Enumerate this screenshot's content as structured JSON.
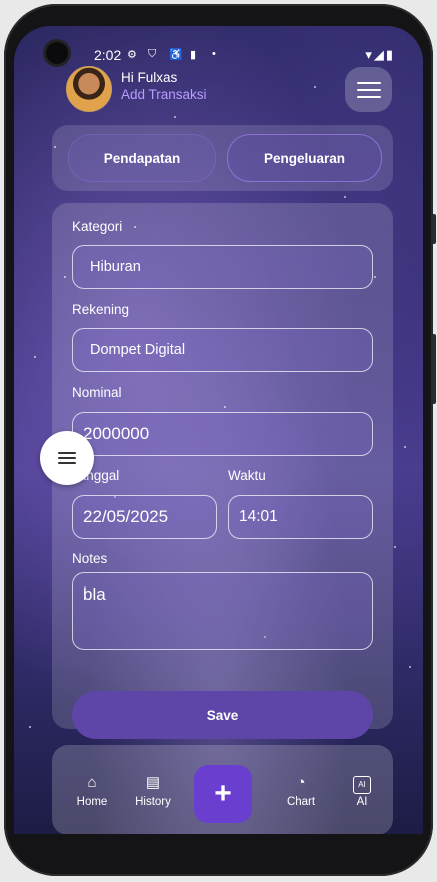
{
  "status_bar": {
    "time": "2:02",
    "dot": "•"
  },
  "header": {
    "greeting": "Hi Fulxas",
    "subtitle": "Add Transaksi"
  },
  "type_switch": {
    "income_label": "Pendapatan",
    "expense_label": "Pengeluaran"
  },
  "form": {
    "category_label": "Kategori",
    "category_value": "Hiburan",
    "account_label": "Rekening",
    "account_value": "Dompet Digital",
    "amount_label": "Nominal",
    "amount_value": "2000000",
    "date_label": "Tanggal",
    "date_value": "22/05/2025",
    "time_label": "Waktu",
    "time_value": "14:01",
    "notes_label": "Notes",
    "notes_value": "bla",
    "save_label": "Save"
  },
  "nav": {
    "home": "Home",
    "history": "History",
    "add": "+",
    "chart": "Chart",
    "ai": "AI"
  },
  "colors": {
    "accent": "#6a3fd0",
    "save_button": "#5e46a8",
    "subtitle": "#b89cff"
  },
  "icons": [
    "settings-icon",
    "shield-icon",
    "accessibility-icon",
    "sd-card-icon",
    "wifi-icon",
    "signal-icon",
    "battery-icon",
    "menu-icon",
    "home-icon",
    "history-icon",
    "plus-icon",
    "chart-icon",
    "ai-chip-icon"
  ]
}
